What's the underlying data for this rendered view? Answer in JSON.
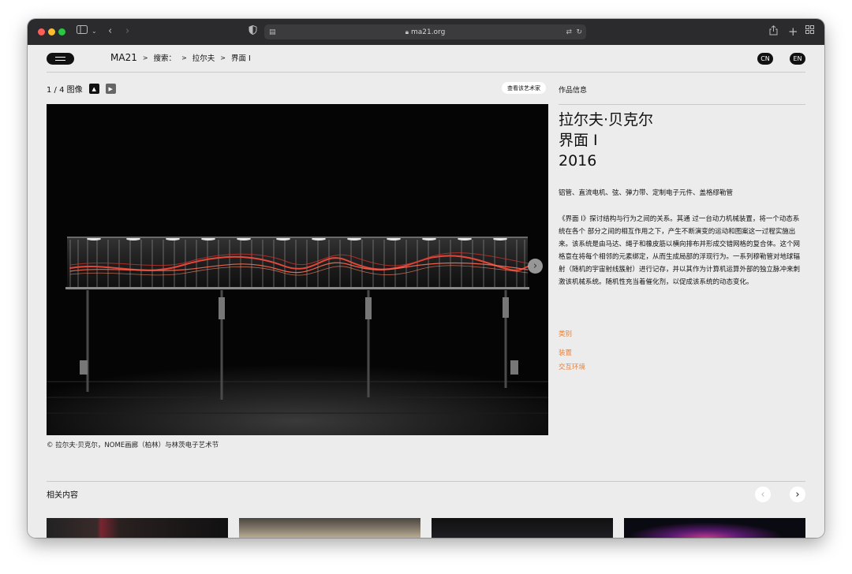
{
  "browser": {
    "url": "ma21.org"
  },
  "nav": {
    "brand": "MA21",
    "sep": ">",
    "search": "搜索：",
    "artist": "拉尔夫",
    "work": "界面 I",
    "lang_cn": "CN",
    "lang_en": "EN"
  },
  "gallery": {
    "counter": "1 / 4 图像",
    "view_artist": "查看该艺术家",
    "caption": "© 拉尔夫·贝克尔，NOME画廊（柏林）与林茨电子艺术节"
  },
  "info": {
    "heading": "作品信息",
    "artist": "拉尔夫·贝克尔",
    "title": "界面 I",
    "year": "2016",
    "materials": "铝管、直流电机、弦、弹力带、定制电子元件、盖格缪勒管",
    "description": "《界面 I》探讨结构与行为之间的关系。其通 过一台动力机械装置，将一个动态系统在各个 部分之间的相互作用之下，产生不断演变的运动和图案这一过程实施出来。该系统是由马达、绳子和橡皮筋以横向排布并形成交错网格的复合体。这个网格意在将每个相邻的元素绑定，从而生成局部的浮现行为。一系列穆勒管对地球辐射（随机的宇宙射线簇射）进行记存，并以其作为计算机运算外部的独立脉冲来刺激该机械系统。随机性充当着催化剂，以促成该系统的动态变化。",
    "category_title": "类别",
    "categories": [
      "装置",
      "交互环境"
    ]
  },
  "related": {
    "title": "相关内容"
  },
  "colors": {
    "accent": "#e87f3a",
    "titlebar": "#2b2a2c",
    "page_bg": "#ececec"
  }
}
